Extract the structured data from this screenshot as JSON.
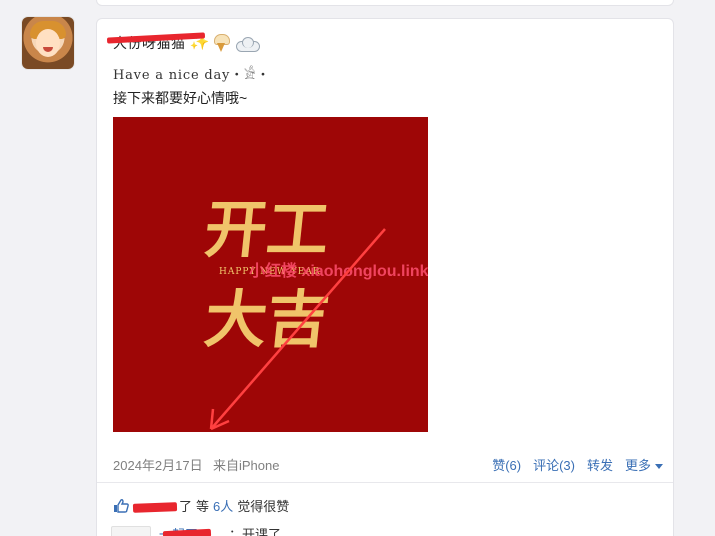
{
  "post": {
    "username_visible": "大份呀猫猫",
    "emoji_sparkles": "✨",
    "tagline": "Have a nice day・𓀀・",
    "text": "接下来都要好心情哦~",
    "image": {
      "line1": "开工",
      "line2": "大吉",
      "subtitle": "HAPPY NEW YEAR",
      "watermark": "小红楼 xiaohonglou.link",
      "bg_color": "#9e0606",
      "gold_color": "#f0c46a"
    },
    "date": "2024年2月17日",
    "source": "来自iPhone"
  },
  "actions": {
    "like": "赞(6)",
    "comment": "评论(3)",
    "repost": "转发",
    "more": "更多"
  },
  "likes": {
    "suffix_1": "了",
    "count_text": "6人",
    "prefix": "等",
    "suffix": "觉得很赞"
  },
  "comment": {
    "user_visible": "一起天",
    "text": "：开课了"
  },
  "colors": {
    "link_blue": "#3a6fb5",
    "redaction_red": "#e8262e"
  }
}
